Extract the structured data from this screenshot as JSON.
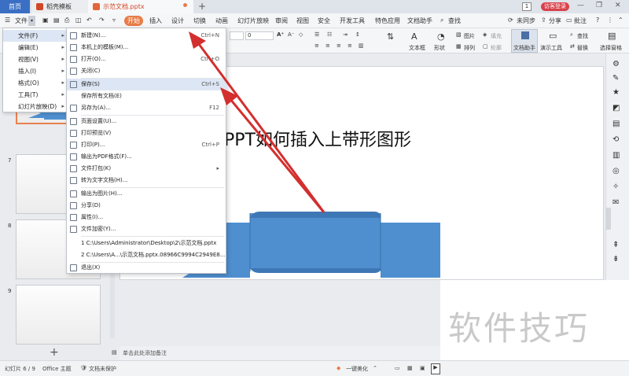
{
  "titlebar": {
    "home_tab": "首页",
    "template_tab": "稻壳模板",
    "doc_tab": "示范文档.pptx",
    "new_tab": "+",
    "page_badge": "1",
    "visitor_btn": "访客登录"
  },
  "menubar": {
    "file_label": "文件",
    "start_label": "开始",
    "tabs": [
      "插入",
      "设计",
      "切换",
      "动画",
      "幻灯片放映",
      "审阅",
      "视图",
      "安全",
      "开发工具",
      "特色应用",
      "文档助手"
    ],
    "search": "查找",
    "sync": "未同步",
    "share": "分享",
    "comment": "批注",
    "help": "?"
  },
  "ribbon": {
    "font_size": "0",
    "text_box": "文本框",
    "shape": "形状",
    "picture": "图片",
    "arrange": "排列",
    "fill": "填充",
    "outline": "轮廓",
    "doc_assistant": "文档助手",
    "presenter": "演示工具",
    "find": "查找",
    "replace": "替换",
    "select_pane": "选择窗格"
  },
  "file_menu": [
    {
      "label": "文件(F)",
      "arrow": "▸"
    },
    {
      "label": "编辑(E)",
      "arrow": "▸"
    },
    {
      "label": "视图(V)",
      "arrow": "▸"
    },
    {
      "label": "插入(I)",
      "arrow": "▸"
    },
    {
      "label": "格式(O)",
      "arrow": "▸"
    },
    {
      "label": "工具(T)",
      "arrow": "▸"
    },
    {
      "label": "幻灯片放映(D)",
      "arrow": "▸"
    }
  ],
  "submenu": [
    {
      "label": "新建(N)...",
      "shortcut": "Ctrl+N"
    },
    {
      "label": "本机上的模板(M)...",
      "shortcut": ""
    },
    {
      "label": "打开(O)...",
      "shortcut": "Ctrl+O"
    },
    {
      "label": "关闭(C)",
      "shortcut": ""
    },
    {
      "label": "保存(S)",
      "shortcut": "Ctrl+S"
    },
    {
      "label": "保存所有文档(E)",
      "shortcut": ""
    },
    {
      "label": "另存为(A)...",
      "shortcut": "F12"
    },
    {
      "label": "页面设置(U)...",
      "shortcut": ""
    },
    {
      "label": "打印预览(V)",
      "shortcut": ""
    },
    {
      "label": "打印(P)...",
      "shortcut": "Ctrl+P"
    },
    {
      "label": "输出为PDF格式(F)...",
      "shortcut": ""
    },
    {
      "label": "文件打包(K)",
      "shortcut": "▸"
    },
    {
      "label": "转为文字文档(H)...",
      "shortcut": ""
    },
    {
      "label": "输出为图片(H)...",
      "shortcut": ""
    },
    {
      "label": "分享(D)",
      "shortcut": ""
    },
    {
      "label": "属性(I)...",
      "shortcut": ""
    },
    {
      "label": "文件加密(Y)...",
      "shortcut": ""
    },
    {
      "label": "1 C:\\Users\\Administrator\\Desktop\\2\\示范文档.pptx",
      "shortcut": ""
    },
    {
      "label": "2 C:\\Users\\A...\\示范文档.pptx.08966C9994C2949E8...",
      "shortcut": ""
    },
    {
      "label": "退出(X)",
      "shortcut": ""
    }
  ],
  "slides": {
    "numbers": [
      "7",
      "8",
      "9"
    ],
    "add": "+"
  },
  "slide": {
    "title": "PPT如何插入上带形图形"
  },
  "notes": {
    "placeholder": "单击此处添加备注"
  },
  "statusbar": {
    "slide_info": "幻灯片 6 / 9",
    "theme": "Office 主题",
    "protect": "文档未保护",
    "beautify": "一键美化"
  },
  "watermark": "软件技巧",
  "colors": {
    "ribbon_shape": "#4f8fd0",
    "ribbon_shape_dark": "#3e77b5",
    "arrow": "#d32f2f",
    "home_tab": "#3a6fc4",
    "start_btn": "#e87c47"
  }
}
